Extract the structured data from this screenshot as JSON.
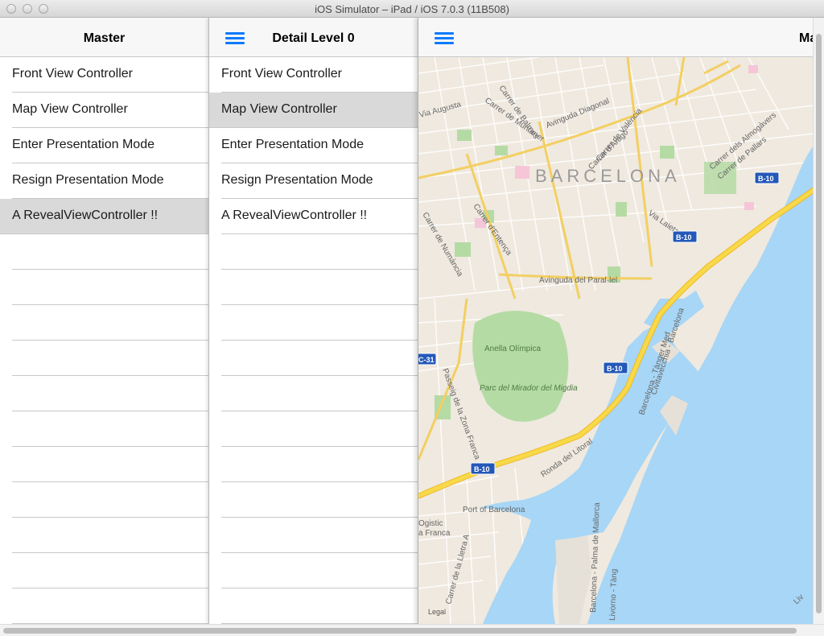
{
  "window": {
    "title": "iOS Simulator – iPad / iOS 7.0.3 (11B508)"
  },
  "master": {
    "title": "Master",
    "items": [
      {
        "label": "Front View Controller"
      },
      {
        "label": "Map View Controller"
      },
      {
        "label": "Enter Presentation Mode"
      },
      {
        "label": "Resign Presentation Mode"
      },
      {
        "label": "A RevealViewController !!",
        "selected": true
      }
    ]
  },
  "detail": {
    "title": "Detail Level 0",
    "items": [
      {
        "label": "Front View Controller"
      },
      {
        "label": "Map View Controller",
        "selected": true
      },
      {
        "label": "Enter Presentation Mode"
      },
      {
        "label": "Resign Presentation Mode"
      },
      {
        "label": "A RevealViewController !!"
      }
    ]
  },
  "front": {
    "title": "Ma",
    "map": {
      "city": "BARCELONA",
      "streets": [
        "Via Augusta",
        "Carrer de Balmes",
        "Avinguda Diagonal",
        "Carrer de Muntaner",
        "Carrer de València",
        "Carrer d'Aragó",
        "Carrer dels Almogàvers",
        "Carrer de Pallars",
        "Via Laietana",
        "Carrer de Numància",
        "Carrer d'Entença",
        "Avinguda del Paral·lel",
        "Passeig de la Zona Franca",
        "Ronda del Litoral",
        "Carrer de la Lletra A"
      ],
      "places": [
        "Anella Olímpica",
        "Parc del Mirador del Migdia",
        "Port of Barcelona",
        "Ogistic",
        "a Franca",
        "Liv"
      ],
      "port": [
        "Barcelona - Tànger Med",
        "Civitavecchia - Barcelona",
        "Barcelona - Palma de Mallorca",
        "Livorno - Tàng"
      ],
      "road_shields": [
        "B-10",
        "B-10",
        "B-10",
        "B-10",
        "C-31"
      ],
      "legal": "Legal"
    }
  },
  "colors": {
    "accent": "#0a7aff",
    "selected_row": "#d9d9d9",
    "map_land": "#efe9df",
    "map_water": "#a7d6f6",
    "map_highway": "#f7c832",
    "map_park": "#b5dba4"
  }
}
